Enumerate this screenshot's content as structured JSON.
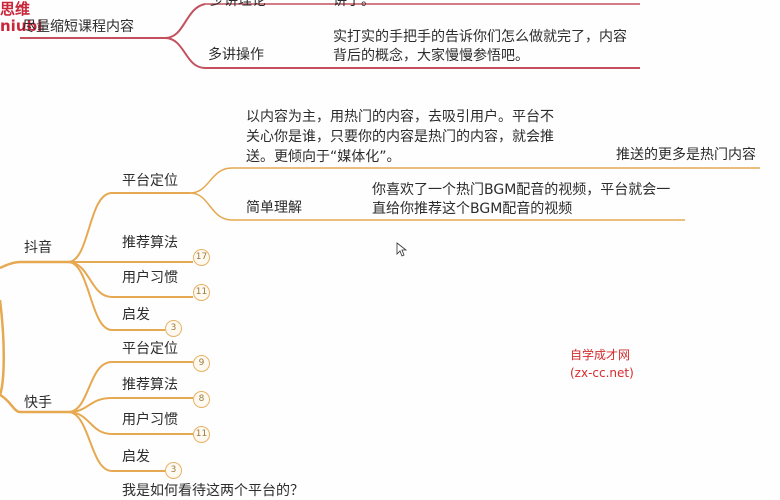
{
  "logo": {
    "line1": "思维",
    "line2": "niubi"
  },
  "top_section": {
    "root": "尽量缩短课程内容",
    "item1_label": "少讲理论",
    "item1_note": "讲了。",
    "item2_label": "多讲操作",
    "item2_note": "实打实的手把手的告诉你们怎么做就完了，内容背后的概念，大家慢慢参悟吧。"
  },
  "douyin": {
    "root": "抖音",
    "platform": {
      "label": "平台定位",
      "description": "以内容为主，用热门的内容，去吸引用户。平台不关心你是谁，只要你的内容是热门的内容，就会推送。更倾向于“媒体化”。",
      "side_note": "推送的更多是热门内容",
      "simple_label": "简单理解",
      "simple_note": "你喜欢了一个热门BGM配音的视频，平台就会一直给你推荐这个BGM配音的视频"
    },
    "items": [
      {
        "label": "推荐算法",
        "count": "17"
      },
      {
        "label": "用户习惯",
        "count": "11"
      },
      {
        "label": "启发",
        "count": "3"
      }
    ]
  },
  "kuaishou": {
    "root": "快手",
    "items": [
      {
        "label": "平台定位",
        "count": "9"
      },
      {
        "label": "推荐算法",
        "count": "8"
      },
      {
        "label": "用户习惯",
        "count": "11"
      },
      {
        "label": "启发",
        "count": "3"
      }
    ]
  },
  "bottom_text": "我是如何看待这两个平台的？",
  "watermark": {
    "line1": "自学成才网",
    "line2": "(zx-cc.net)"
  },
  "colors": {
    "branch_top": "#c4505d",
    "branch_main": "#e6a850",
    "badge_border": "#e7b266"
  },
  "cursor_icon": "mouse-pointer-icon"
}
